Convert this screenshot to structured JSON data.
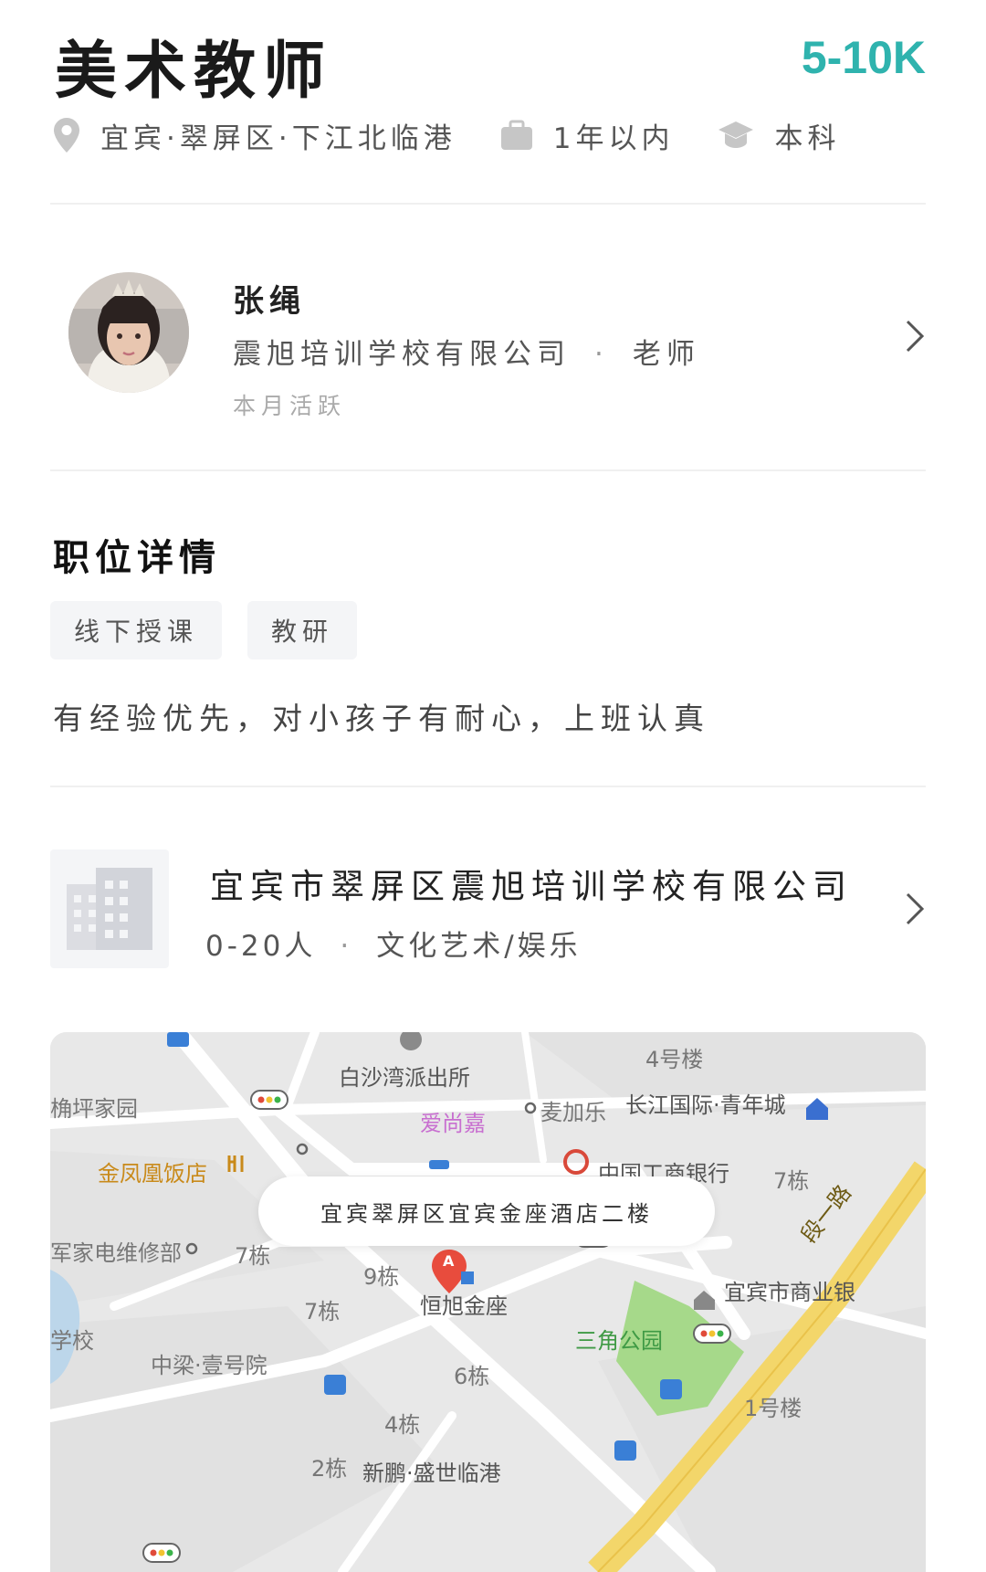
{
  "job": {
    "title": "美术教师",
    "salary": "5-10K",
    "location": "宜宾·翠屏区·下江北临港",
    "experience": "1年以内",
    "education": "本科"
  },
  "recruiter": {
    "name": "张绳",
    "company": "震旭培训学校有限公司",
    "separator": "·",
    "role": "老师",
    "activity": "本月活跃"
  },
  "details": {
    "section_title": "职位详情",
    "tags": [
      "线下授课",
      "教研"
    ],
    "description": "有经验优先，对小孩子有耐心，上班认真"
  },
  "company": {
    "name": "宜宾市翠屏区震旭培训学校有限公司",
    "size": "0-20人",
    "separator": "·",
    "industry": "文化艺术/娱乐"
  },
  "map": {
    "address": "宜宾翠屏区宜宾金座酒店二楼",
    "labels": {
      "police": "白沙湾派出所",
      "building4": "4号楼",
      "garden": "桷坪家园",
      "aishangjia": "爱尚嘉",
      "maijiale": "麦加乐",
      "changjiang": "长江国际·青年城",
      "hotel": "金凤凰饭店",
      "icbc": "中国工商银行",
      "b7a": "7栋",
      "repair": "军家电维修部",
      "b7b": "7栋",
      "b9": "9栋",
      "hengxu": "恒旭金座",
      "b7c": "7栋",
      "commercial_bank": "宜宾市商业银",
      "school": "学校",
      "sanjiao": "三角公园",
      "zhongliang": "中梁·壹号院",
      "b6": "6栋",
      "b1": "1号楼",
      "b4": "4栋",
      "b2": "2栋",
      "xinpeng": "新鹏·盛世临港",
      "road": "段一路",
      "marker": "A"
    }
  },
  "colors": {
    "salary": "#2fb3ae",
    "park": "#a6d98a",
    "road_main": "#f3d66a",
    "marker": "#e84c3d"
  }
}
